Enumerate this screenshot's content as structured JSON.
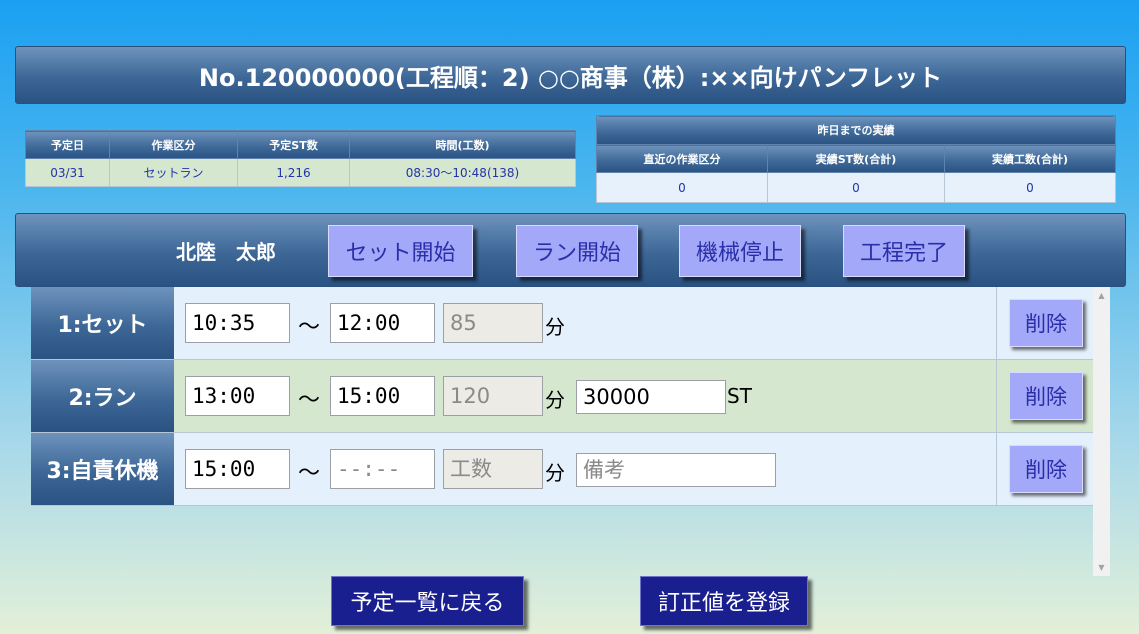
{
  "title": "No.120000000(工程順：2) ○○商事（株）:××向けパンフレット",
  "schedule": {
    "headers": [
      "予定日",
      "作業区分",
      "予定ST数",
      "時間(工数)"
    ],
    "values": [
      "03/31",
      "セットラン",
      "1,216",
      "08:30～10:48(138)"
    ]
  },
  "actual": {
    "title": "昨日までの実績",
    "headers": [
      "直近の作業区分",
      "実績ST数(合計)",
      "実績工数(合計)"
    ],
    "values": [
      "0",
      "0",
      "0"
    ]
  },
  "operator": "北陸　太郎",
  "buttons": {
    "set_start": "セット開始",
    "run_start": "ラン開始",
    "machine_stop": "機械停止",
    "process_done": "工程完了",
    "back": "予定一覧に戻る",
    "register": "訂正値を登録"
  },
  "tilde": "～",
  "unit_min": "分",
  "unit_st": "ST",
  "delete_label": "削除",
  "rows": [
    {
      "label": "1:セット",
      "start": "10:35",
      "end": "12:00",
      "minutes": "85"
    },
    {
      "label": "2:ラン",
      "start": "13:00",
      "end": "15:00",
      "minutes": "120",
      "st": "30000"
    },
    {
      "label": "3:自責休機",
      "start": "15:00",
      "end_placeholder": "--:--",
      "minutes_placeholder": "工数",
      "note_placeholder": "備考"
    }
  ],
  "icons": {
    "scroll_up": "triangle-up",
    "scroll_down": "triangle-down"
  }
}
